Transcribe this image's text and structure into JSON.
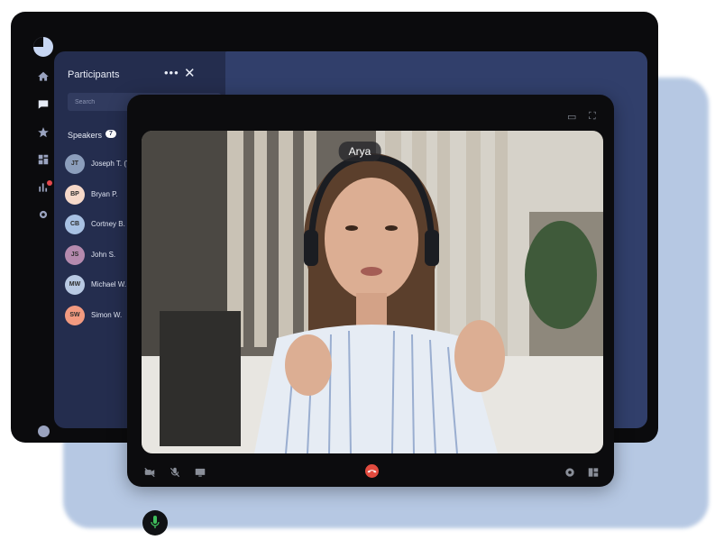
{
  "participants_panel": {
    "title": "Participants",
    "more_icon": "more-horizontal-icon",
    "close_icon": "close-icon",
    "search_placeholder": "Search",
    "speakers_label": "Speakers",
    "speakers_count": "7",
    "items": [
      {
        "initials": "JT",
        "name": "Joseph T. (You)",
        "avatar_color": "#8c9ebc"
      },
      {
        "initials": "BP",
        "name": "Bryan P.",
        "avatar_color": "#f6d8c9"
      },
      {
        "initials": "CB",
        "name": "Cortney B.",
        "avatar_color": "#a8c1e3"
      },
      {
        "initials": "JS",
        "name": "John S.",
        "avatar_color": "#b58aae"
      },
      {
        "initials": "MW",
        "name": "Michael W.",
        "avatar_color": "#b8c9e3"
      },
      {
        "initials": "SW",
        "name": "Simon W.",
        "avatar_color": "#f29a80"
      }
    ]
  },
  "video": {
    "speaker_name": "Arya"
  },
  "left_rail": {
    "icons": [
      "home-icon",
      "chat-icon",
      "star-icon",
      "grid-icon",
      "chart-icon",
      "settings-icon",
      "user-icon"
    ]
  },
  "controls": {
    "icons": [
      "camera-off-icon",
      "mic-off-icon",
      "share-screen-icon",
      "end-call-icon",
      "settings-icon",
      "layout-icon"
    ]
  },
  "colors": {
    "app_bg": "#0b0b0d",
    "sidebar_bg": "#242d4e",
    "panel_bg": "#313f6b",
    "end_call": "#e24b3f",
    "mic_active": "#3fbf5c",
    "backdrop": "#b3c6e2"
  }
}
